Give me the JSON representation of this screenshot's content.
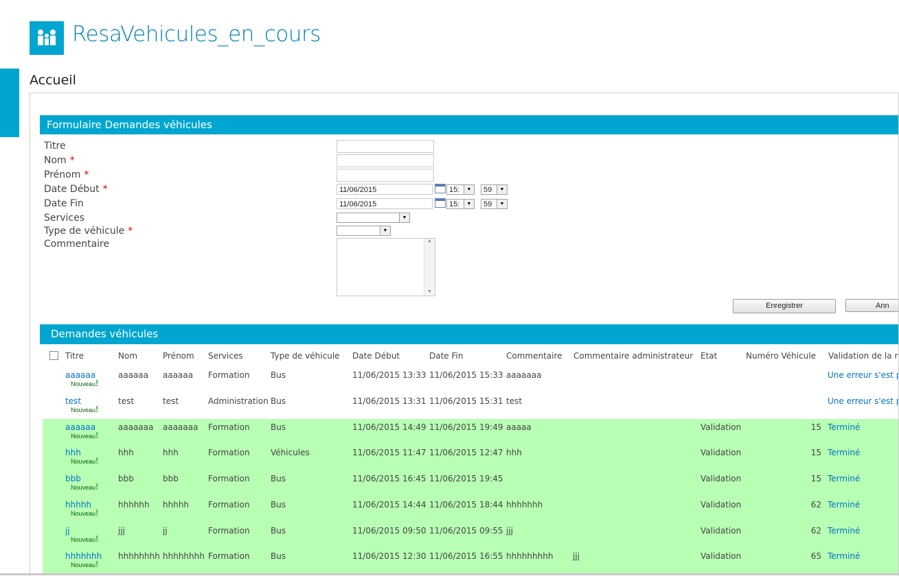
{
  "site": {
    "title": "ResaVehicules_en_cours",
    "logo_icon": "people-icon"
  },
  "page": {
    "title": "Accueil"
  },
  "form": {
    "header": "Formulaire Demandes véhicules",
    "fields": {
      "titre": {
        "label": "Titre",
        "required": false
      },
      "nom": {
        "label": "Nom",
        "required": true
      },
      "prenom": {
        "label": "Prénom",
        "required": true
      },
      "date_debut": {
        "label": "Date Début",
        "required": true,
        "date": "11/06/2015",
        "hour": "15:",
        "minute": "59"
      },
      "date_fin": {
        "label": "Date Fin",
        "required": false,
        "date": "11/06/2015",
        "hour": "15:",
        "minute": "59"
      },
      "services": {
        "label": "Services",
        "required": false,
        "value": ""
      },
      "type_vehicule": {
        "label": "Type de véhicule",
        "required": true,
        "value": ""
      },
      "commentaire": {
        "label": "Commentaire",
        "required": false,
        "value": ""
      }
    },
    "required_marker": "*",
    "save_label": "Enregistrer",
    "cancel_label": "Ann"
  },
  "list": {
    "header": "Demandes véhicules",
    "nouveau_label": "Nouveau",
    "nouveau_mark": "!",
    "columns": [
      "Titre",
      "Nom",
      "Prénom",
      "Services",
      "Type de véhicule",
      "Date Début",
      "Date Fin",
      "Commentaire",
      "Commentaire administrateur",
      "Etat",
      "Numéro Véhicule",
      "Validation de la re"
    ],
    "rows": [
      {
        "titre": "aaaaaa",
        "nom": "aaaaaa",
        "prenom": "aaaaaa",
        "services": "Formation",
        "type": "Bus",
        "debut": "11/06/2015 13:33",
        "fin": "11/06/2015 15:33",
        "commentaire": "aaaaaaa",
        "admin": "",
        "etat": "",
        "numero": "",
        "validation": "Une erreur s'est p",
        "done": false
      },
      {
        "titre": "test",
        "nom": "test",
        "prenom": "test",
        "services": "Administration",
        "type": "Bus",
        "debut": "11/06/2015 13:31",
        "fin": "11/06/2015 15:31",
        "commentaire": "test",
        "admin": "",
        "etat": "",
        "numero": "",
        "validation": "Une erreur s'est p",
        "done": false
      },
      {
        "titre": "aaaaaa",
        "nom": "aaaaaaa",
        "prenom": "aaaaaaa",
        "services": "Formation",
        "type": "Bus",
        "debut": "11/06/2015 14:49",
        "fin": "11/06/2015 19:49",
        "commentaire": "aaaaa",
        "admin": "",
        "etat": "Validation",
        "numero": "15",
        "validation": "Terminé",
        "done": true
      },
      {
        "titre": "hhh",
        "nom": "hhh",
        "prenom": "hhh",
        "services": "Formation",
        "type": "Véhicules",
        "debut": "11/06/2015 11:47",
        "fin": "11/06/2015 12:47",
        "commentaire": "hhh",
        "admin": "",
        "etat": "Validation",
        "numero": "15",
        "validation": "Terminé",
        "done": true
      },
      {
        "titre": "bbb",
        "nom": "bbb",
        "prenom": "bbb",
        "services": "Formation",
        "type": "Bus",
        "debut": "11/06/2015 16:45",
        "fin": "11/06/2015 19:45",
        "commentaire": "",
        "admin": "",
        "etat": "Validation",
        "numero": "15",
        "validation": "Terminé",
        "done": true
      },
      {
        "titre": "hhhhh",
        "nom": "hhhhhh",
        "prenom": "hhhhh",
        "services": "Formation",
        "type": "Bus",
        "debut": "11/06/2015 14:44",
        "fin": "11/06/2015 18:44",
        "commentaire": "hhhhhhh",
        "admin": "",
        "etat": "Validation",
        "numero": "62",
        "validation": "Terminé",
        "done": true
      },
      {
        "titre": "jj",
        "nom": "jjj",
        "prenom": "jj",
        "services": "Formation",
        "type": "Bus",
        "debut": "11/06/2015 09:50",
        "fin": "11/06/2015 09:55",
        "commentaire": "jjj",
        "admin": "",
        "etat": "Validation",
        "numero": "62",
        "validation": "Terminé",
        "done": true
      },
      {
        "titre": "hhhhhhh",
        "nom": "hhhhhhhh",
        "prenom": "hhhhhhhh",
        "services": "Formation",
        "type": "Bus",
        "debut": "11/06/2015 12:30",
        "fin": "11/06/2015 16:55",
        "commentaire": "hhhhhhhhh",
        "admin": "jjj",
        "etat": "Validation",
        "numero": "65",
        "validation": "Terminé",
        "done": true
      }
    ]
  },
  "colors": {
    "accent": "#00a6cf",
    "title": "#0080b8",
    "link": "#0072c6",
    "done_row": "#b8ffb4",
    "required": "#cc0000"
  }
}
